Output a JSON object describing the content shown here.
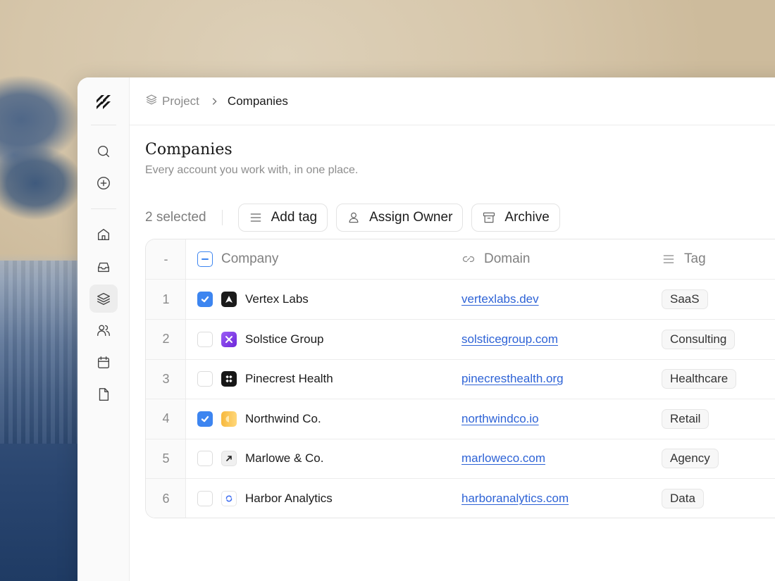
{
  "breadcrumb": {
    "parent": "Project",
    "current": "Companies"
  },
  "page": {
    "title": "Companies",
    "subtitle": "Every account you work with, in one place."
  },
  "toolbar": {
    "selected_count": "2 selected",
    "add_tag": "Add tag",
    "assign_owner": "Assign Owner",
    "archive": "Archive"
  },
  "table": {
    "index_header": "-",
    "columns": {
      "company": "Company",
      "domain": "Domain",
      "tag": "Tag"
    },
    "rows": [
      {
        "index": "1",
        "checked": true,
        "company": "Vertex Labs",
        "domain": "vertexlabs.dev",
        "tag": "SaaS",
        "logo": "vertex-logo"
      },
      {
        "index": "2",
        "checked": false,
        "company": "Solstice Group",
        "domain": "solsticegroup.com",
        "tag": "Consulting",
        "logo": "solstice-logo"
      },
      {
        "index": "3",
        "checked": false,
        "company": "Pinecrest Health",
        "domain": "pinecresthealth.org",
        "tag": "Healthcare",
        "logo": "pinecrest-logo"
      },
      {
        "index": "4",
        "checked": true,
        "company": "Northwind Co.",
        "domain": "northwindco.io",
        "tag": "Retail",
        "logo": "northwind-logo"
      },
      {
        "index": "5",
        "checked": false,
        "company": "Marlowe & Co.",
        "domain": "marloweco.com",
        "tag": "Agency",
        "logo": "marlowe-logo"
      },
      {
        "index": "6",
        "checked": false,
        "company": "Harbor Analytics",
        "domain": "harboranalytics.com",
        "tag": "Data",
        "logo": "harbor-logo"
      }
    ]
  },
  "sidebar": {
    "icons": [
      "search-icon",
      "plus-circle-icon",
      "home-icon",
      "inbox-icon",
      "layers-icon",
      "users-icon",
      "calendar-icon",
      "file-icon"
    ],
    "active": "layers-icon"
  },
  "colors": {
    "accent": "#3d85f0",
    "link": "#2e63d6"
  }
}
